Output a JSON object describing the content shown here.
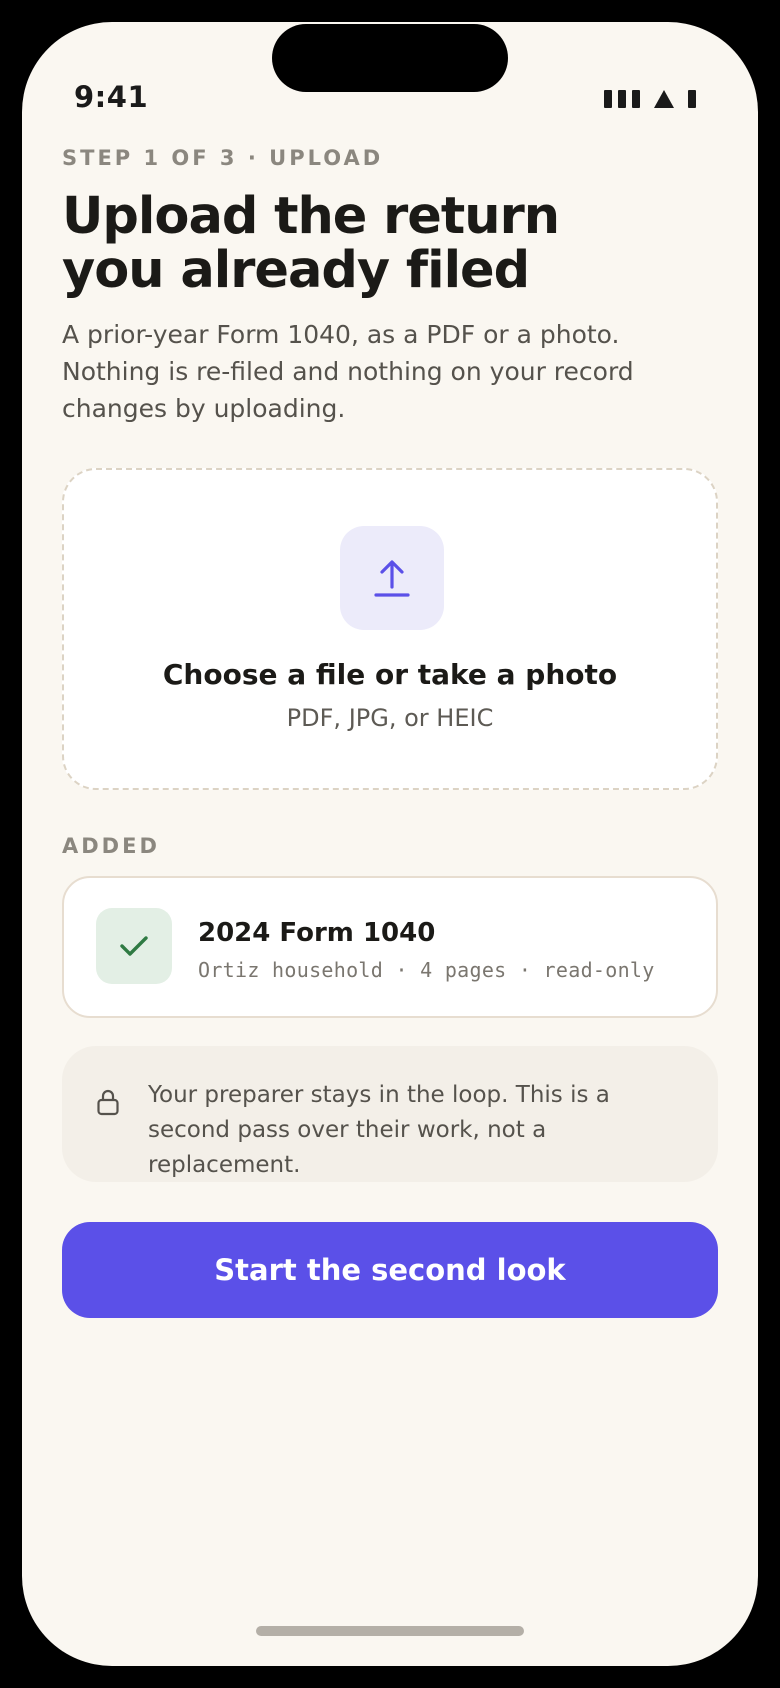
{
  "status": {
    "time": "9:41"
  },
  "step_label": "STEP 1 OF 3 · UPLOAD",
  "title": {
    "line1": "Upload the return",
    "line2": "you already filed"
  },
  "description": "A prior-year Form 1040, as a PDF or a photo. Nothing is re-filed and nothing on your record changes by uploading.",
  "dropzone": {
    "icon": "upload-arrow-icon",
    "title": "Choose a file or take a photo",
    "subtitle": "PDF, JPG, or HEIC"
  },
  "added": {
    "label": "ADDED",
    "file": {
      "icon": "check-icon",
      "name": "2024 Form 1040",
      "meta": "Ortiz household · 4 pages · read-only"
    }
  },
  "note": {
    "icon": "lock-icon",
    "text": "Your preparer stays in the loop. This is a second pass over their work, not a replacement."
  },
  "cta": {
    "label": "Start the second look"
  },
  "colors": {
    "background": "#faf7f1",
    "accent": "#5b50e8",
    "success": "#2f7a43",
    "muted": "#8b877f"
  }
}
